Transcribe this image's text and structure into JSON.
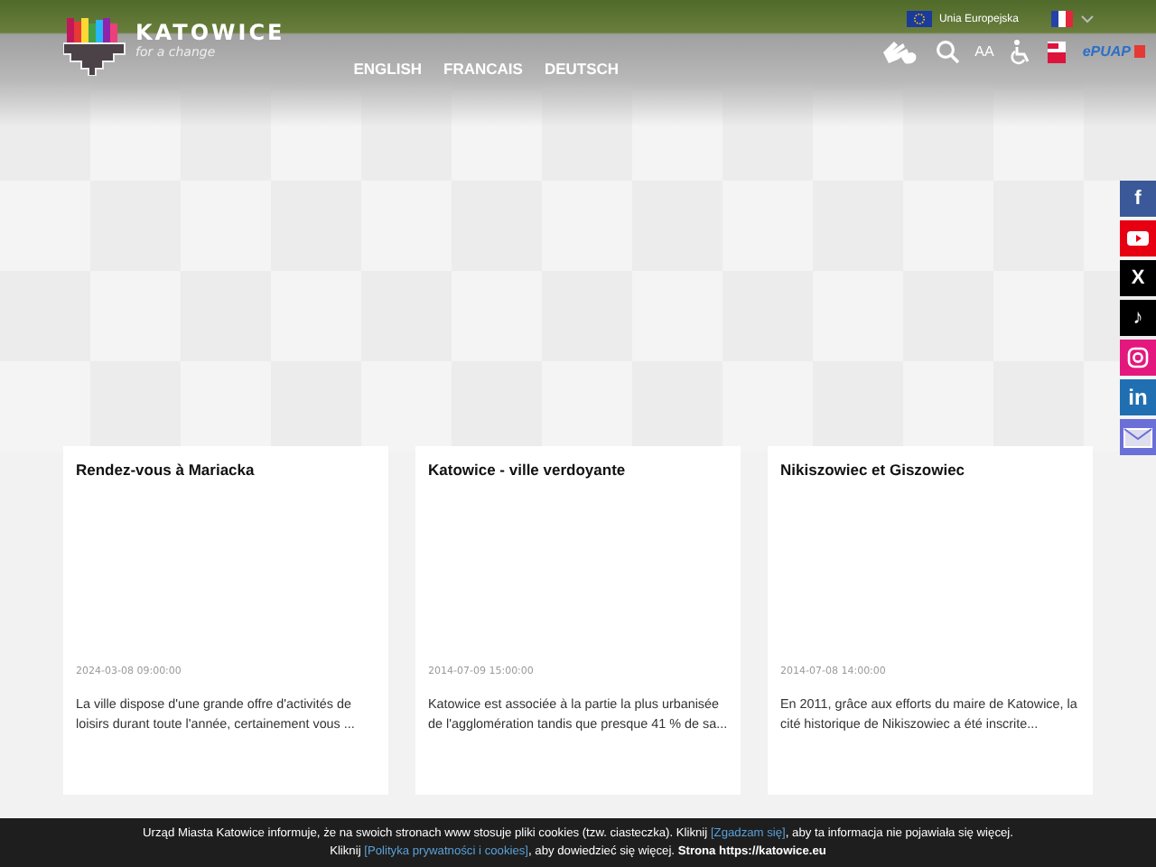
{
  "logo": {
    "name": "KATOWICE",
    "tagline": "for a change"
  },
  "languages": [
    {
      "label": "ENGLISH"
    },
    {
      "label": "FRANCAIS"
    },
    {
      "label": "DEUTSCH"
    }
  ],
  "topbar": {
    "eu_label": "Unia Europejska"
  },
  "tools": [
    {
      "kind": "sign"
    },
    {
      "kind": "search"
    },
    {
      "kind": "text",
      "glyph": "AA"
    },
    {
      "kind": "wheelchair"
    },
    {
      "kind": "flag"
    },
    {
      "kind": "epuap",
      "glyph": "ePUAP"
    }
  ],
  "cards": [
    {
      "title": "Rendez-vous à Mariacka",
      "date": "2024-03-08 09:00:00",
      "excerpt": "La ville dispose d'une grande offre d'activités de loisirs durant toute l'année, certainement vous ..."
    },
    {
      "title": "Katowice - ville verdoyante",
      "date": "2014-07-09 15:00:00",
      "excerpt": "Katowice est associée à la partie la plus urbanisée de l'agglomération tandis que presque 41 % de sa..."
    },
    {
      "title": "Nikiszowiec et Giszowiec",
      "date": "2014-07-08 14:00:00",
      "excerpt": "En 2011, grâce aux efforts du maire de Katowice, la cité historique de Nikiszowiec a été inscrite..."
    }
  ],
  "social": [
    {
      "kind": "facebook",
      "glyph": "f",
      "color": "#3b5998"
    },
    {
      "kind": "youtube",
      "color": "#e60012"
    },
    {
      "kind": "x",
      "glyph": "X",
      "color": "#000000"
    },
    {
      "kind": "tiktok",
      "glyph": "♪",
      "color": "#000000"
    },
    {
      "kind": "instagram",
      "color": "#e4177f"
    },
    {
      "kind": "linkedin",
      "glyph": "in",
      "color": "#1f6fb2"
    },
    {
      "kind": "mail",
      "color": "#6b6fd8"
    }
  ],
  "cookie_banner": {
    "lines": [
      [
        {
          "kind": "text",
          "text": "Urząd Miasta Katowice informuje, że na swoich stronach www stosuje pliki cookies (tzw. ciasteczka). Kliknij "
        },
        {
          "kind": "link",
          "text": "[Zgadzam się]"
        },
        {
          "kind": "text",
          "text": ", aby ta informacja nie pojawiała się więcej."
        }
      ],
      [
        {
          "kind": "text",
          "text": "Kliknij "
        },
        {
          "kind": "link",
          "text": "[Polityka prywatności i cookies]"
        },
        {
          "kind": "text",
          "text": ", aby dowiedzieć się więcej.  **Strona https://katowice.eu**"
        }
      ]
    ]
  }
}
